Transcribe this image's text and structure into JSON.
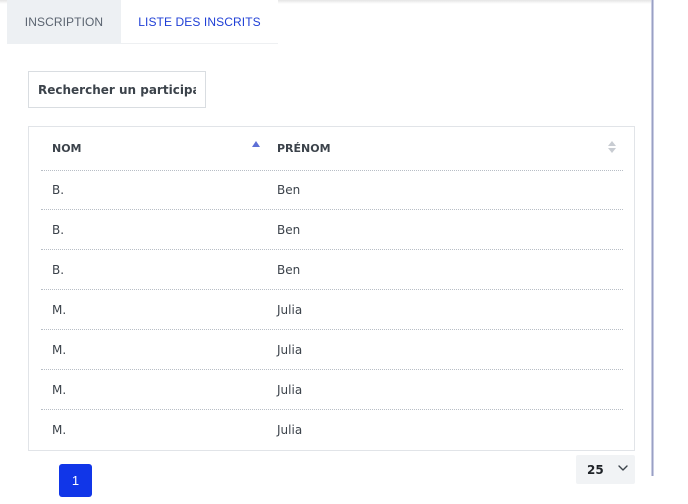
{
  "tabs": [
    {
      "label": "INSCRIPTION",
      "active": false
    },
    {
      "label": "LISTE DES INSCRITS",
      "active": true
    }
  ],
  "search": {
    "placeholder": "Rechercher un participant",
    "value": ""
  },
  "table": {
    "columns": [
      {
        "label": "NOM",
        "sort": "ascending"
      },
      {
        "label": "PRÉNOM",
        "sort": "none"
      }
    ],
    "rows": [
      {
        "nom": "B.",
        "prenom": "Ben"
      },
      {
        "nom": "B.",
        "prenom": "Ben"
      },
      {
        "nom": "B.",
        "prenom": "Ben"
      },
      {
        "nom": "M.",
        "prenom": "Julia"
      },
      {
        "nom": "M.",
        "prenom": "Julia"
      },
      {
        "nom": "M.",
        "prenom": "Julia"
      },
      {
        "nom": "M.",
        "prenom": "Julia"
      }
    ]
  },
  "pagination": {
    "current_page": "1",
    "per_page": "25"
  },
  "icons": {
    "sort_asc": "sort-ascending-icon",
    "sort_both": "sort-icon",
    "chevron": "chevron-down-icon"
  },
  "colors": {
    "accent": "#1136e8",
    "active_tab_text": "#1f3fd6",
    "sort_active": "#5d6fd6"
  }
}
